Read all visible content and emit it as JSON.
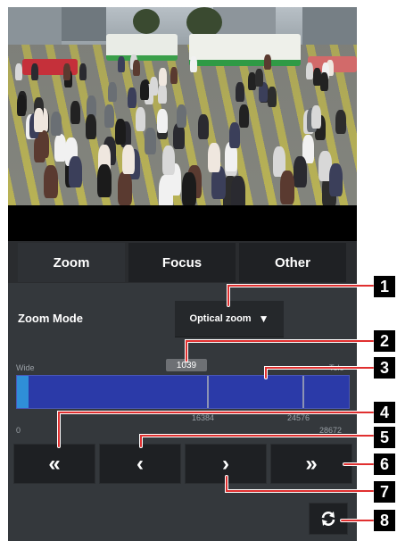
{
  "tabs": [
    {
      "label": "Zoom",
      "active": true
    },
    {
      "label": "Focus",
      "active": false
    },
    {
      "label": "Other",
      "active": false
    }
  ],
  "zoom_mode": {
    "label": "Zoom Mode",
    "selected": "Optical zoom",
    "arrow": "▼"
  },
  "zoom_bar": {
    "current_value": "1039",
    "wide_label": "Wide",
    "tele_label": "Tele",
    "scale": {
      "min": "0",
      "mark1": "16384",
      "mark2": "24576",
      "max": "28672"
    },
    "level_fraction": 0.036
  },
  "buttons": {
    "fast_wide": "«",
    "wide": "‹",
    "tele": "›",
    "fast_tele": "»"
  },
  "callouts": [
    "1",
    "2",
    "3",
    "4",
    "5",
    "6",
    "7",
    "8"
  ],
  "icons": {
    "dropdown_arrow": "triangle-down-icon",
    "refresh": "refresh-icon"
  },
  "colors": {
    "panel_bg": "#34383c",
    "bar_blue": "#2b3aa8",
    "bar_level": "#2f8fd8",
    "callout_line": "#e03030"
  }
}
